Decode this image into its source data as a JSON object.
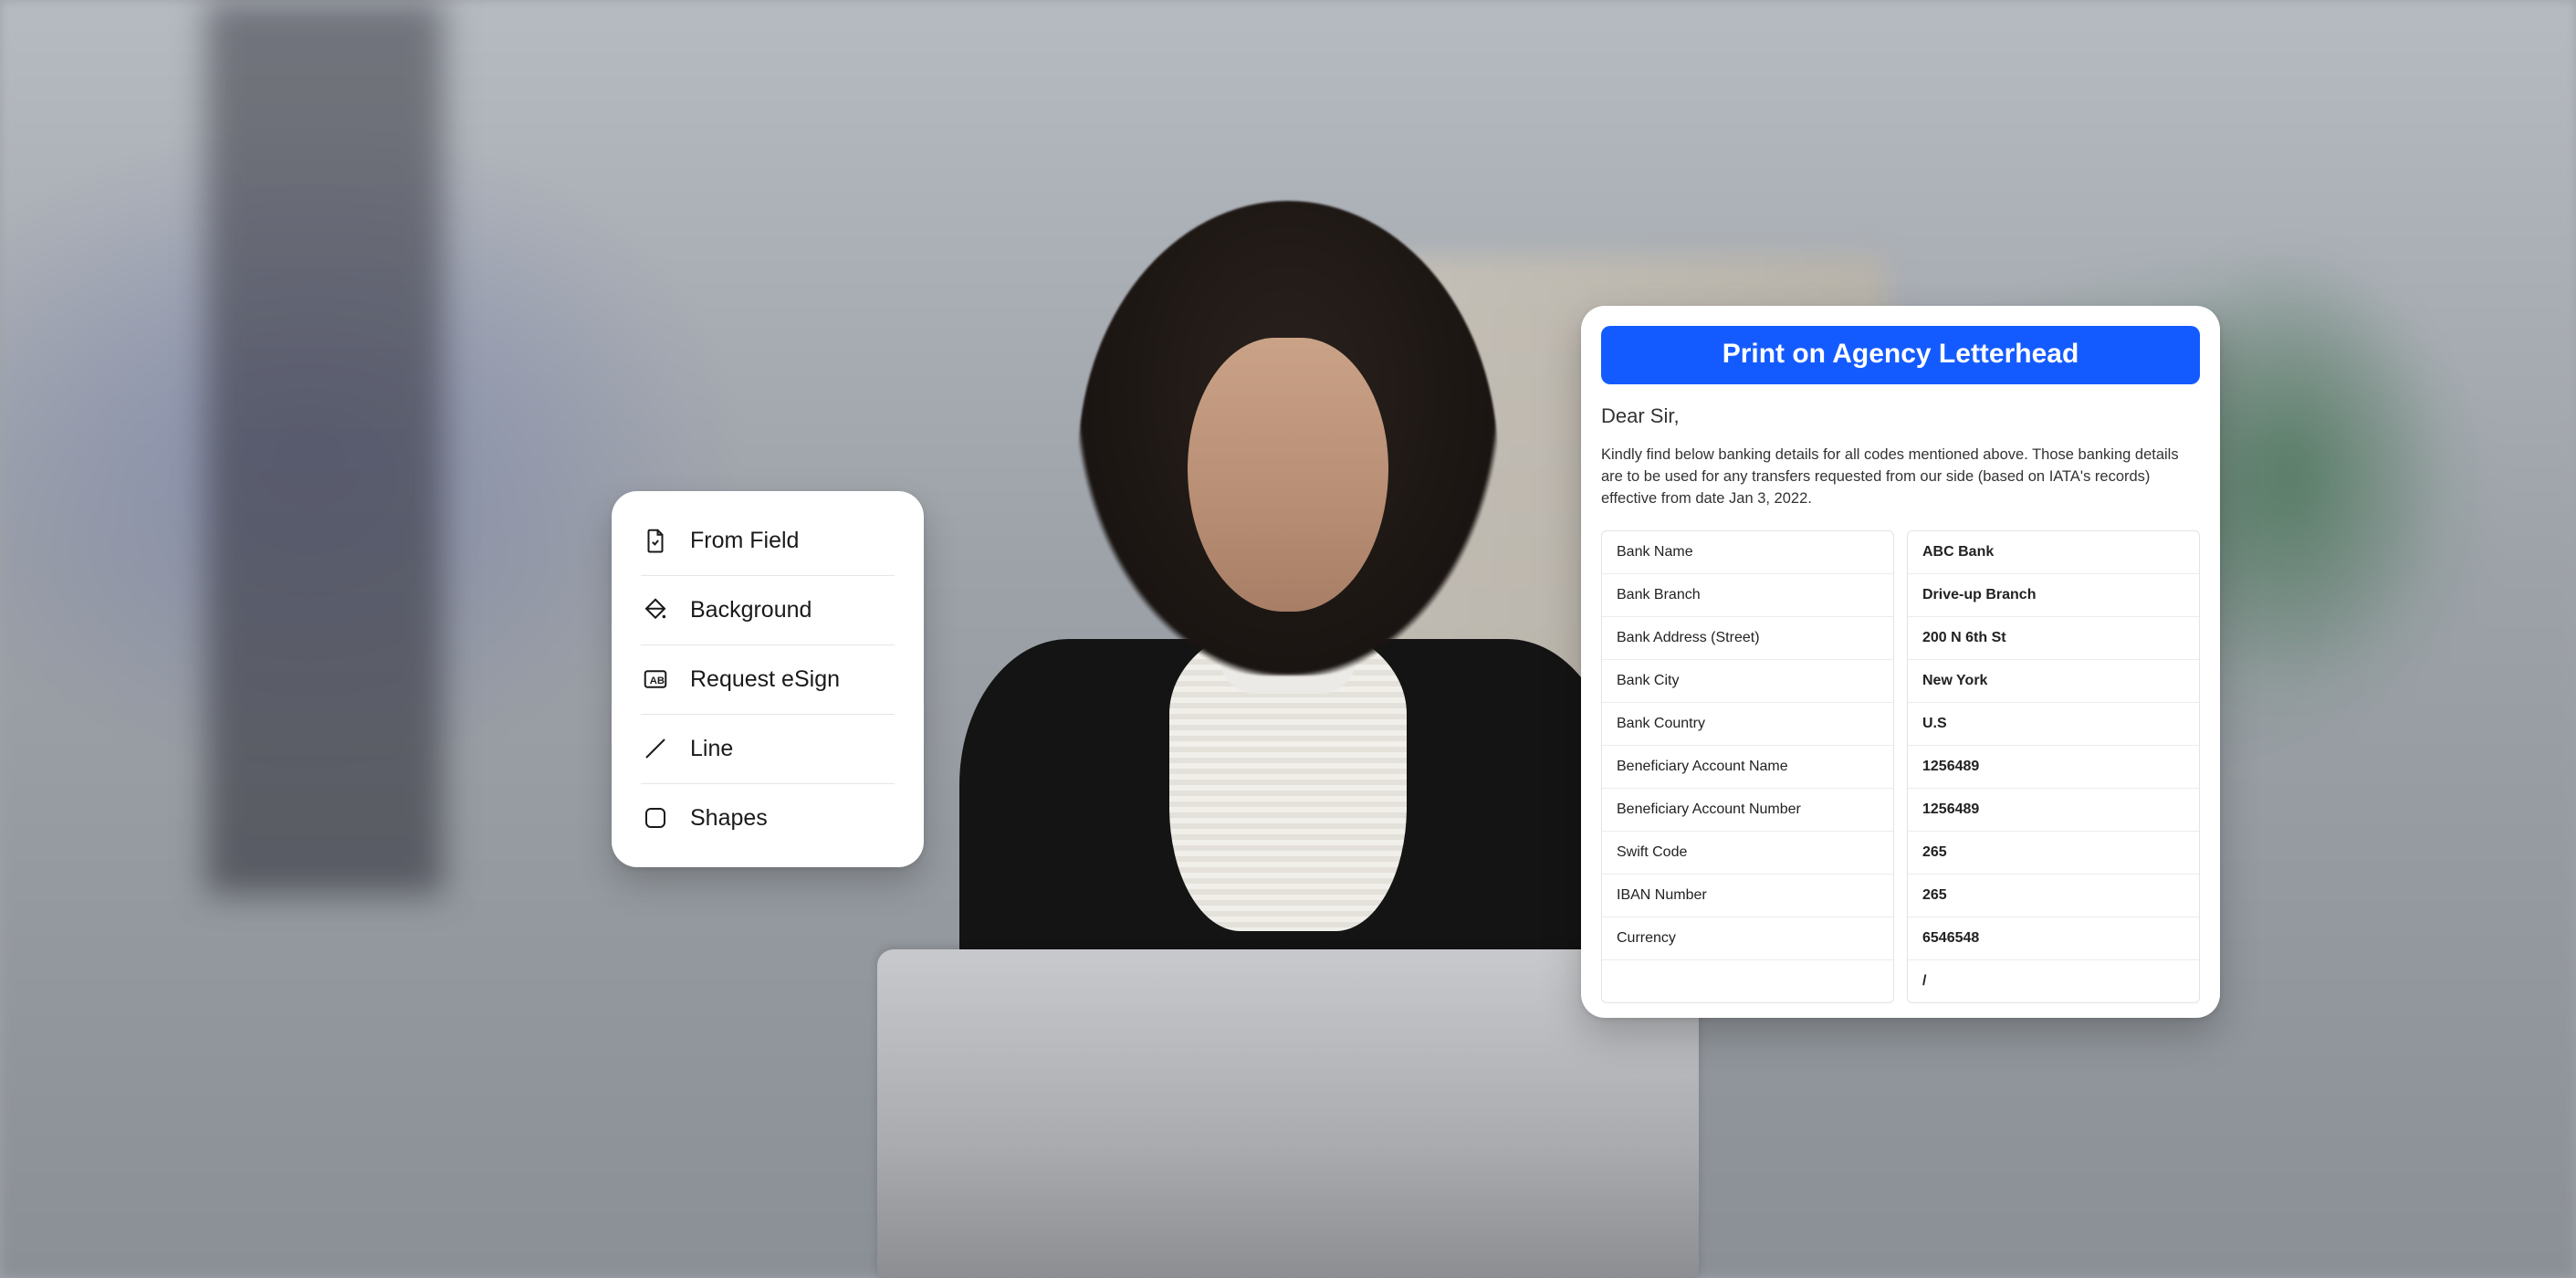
{
  "toolPanel": {
    "items": [
      {
        "label": "From Field",
        "name": "from-field",
        "icon": "file-icon"
      },
      {
        "label": "Background",
        "name": "background",
        "icon": "fill-icon"
      },
      {
        "label": "Request eSign",
        "name": "request-esign",
        "icon": "esign-icon"
      },
      {
        "label": "Line",
        "name": "line",
        "icon": "line-icon"
      },
      {
        "label": "Shapes",
        "name": "shapes",
        "icon": "shape-icon"
      }
    ]
  },
  "document": {
    "headerLabel": "Print on Agency Letterhead",
    "salutation": "Dear Sir,",
    "intro": "Kindly find below banking details for all codes mentioned above. Those banking details are to be used for any transfers requested from our side (based on IATA's records) effective from date Jan 3, 2022.",
    "rows": [
      {
        "label": "Bank Name",
        "value": "ABC Bank"
      },
      {
        "label": "Bank Branch",
        "value": "Drive-up Branch"
      },
      {
        "label": "Bank Address (Street)",
        "value": "200 N 6th St"
      },
      {
        "label": "Bank City",
        "value": "New York"
      },
      {
        "label": "Bank Country",
        "value": "U.S"
      },
      {
        "label": "Beneficiary Account Name",
        "value": "1256489"
      },
      {
        "label": "Beneficiary Account Number",
        "value": "1256489"
      },
      {
        "label": "Swift Code",
        "value": "265"
      },
      {
        "label": "IBAN Number",
        "value": "265"
      },
      {
        "label": "Currency",
        "value": "6546548"
      },
      {
        "label": "",
        "value": "/"
      }
    ]
  }
}
